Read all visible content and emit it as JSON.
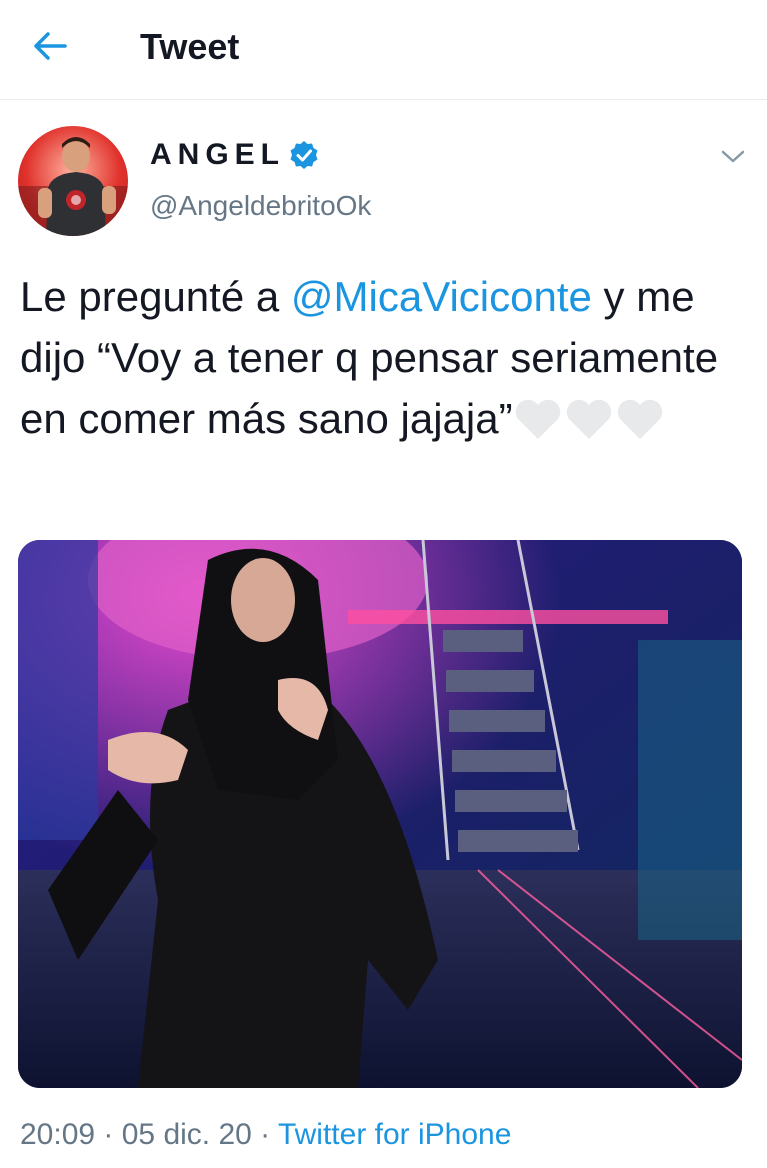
{
  "header": {
    "title": "Tweet"
  },
  "author": {
    "name": "ANGEL",
    "handle": "@AngeldebritoOk"
  },
  "tweet": {
    "text_before": "Le pregunté a ",
    "mention": "@MicaViciconte",
    "text_after": " y me dijo “Voy a tener q pensar seriamente en comer más sano jajaja”"
  },
  "meta": {
    "time": "20:09",
    "sep1": " · ",
    "date": "05 dic. 20",
    "sep2": " · ",
    "source": "Twitter for iPhone"
  },
  "icons": [
    "back-arrow-icon",
    "verified-badge-icon",
    "chevron-down-icon",
    "white-heart-icon"
  ],
  "colors": {
    "accent": "#1b95e0",
    "secondary_text": "#657786",
    "primary_text": "#141823"
  }
}
